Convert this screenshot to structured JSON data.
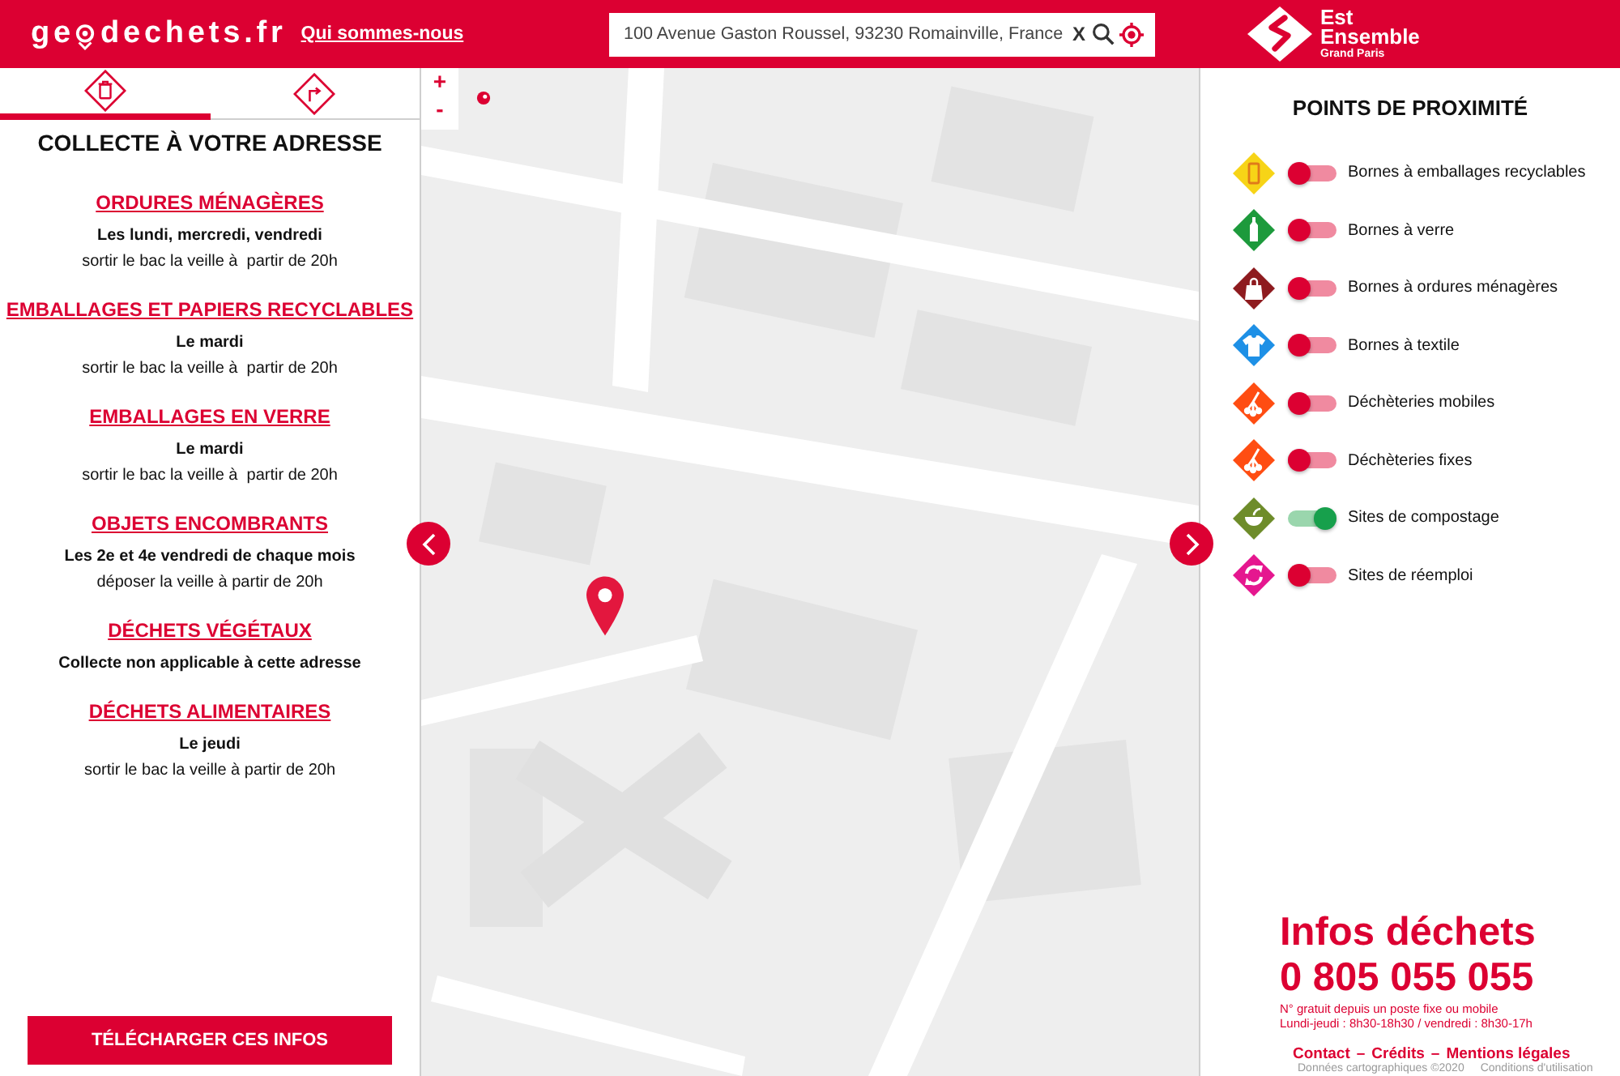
{
  "header": {
    "logo": {
      "before": "ge",
      "after": "dechets.fr"
    },
    "about_link": "Qui sommes-nous",
    "search": {
      "value": "100 Avenue Gaston Roussel, 93230 Romainville, France",
      "clear": "X"
    },
    "brand": [
      "Est",
      "Ensemble",
      "Grand Paris"
    ]
  },
  "left_panel": {
    "tabs": [
      {
        "selected": true
      },
      {
        "selected": false
      }
    ],
    "title": "COLLECTE À VOTRE ADRESSE",
    "sections": [
      {
        "heading": "ORDURES MÉNAGÈRES",
        "schedule": "Les lundi, mercredi, vendredi",
        "note": "sortir le bac la veille à  partir de 20h"
      },
      {
        "heading": "EMBALLAGES ET PAPIERS RECYCLABLES",
        "schedule": "Le mardi",
        "note": "sortir le bac la veille à  partir de 20h"
      },
      {
        "heading": "EMBALLAGES EN VERRE",
        "schedule": "Le mardi",
        "note": "sortir le bac la veille à  partir de 20h"
      },
      {
        "heading": "OBJETS ENCOMBRANTS",
        "schedule": "Les 2e et 4e vendredi de chaque mois",
        "note": "déposer la veille à partir de 20h"
      },
      {
        "heading": "DÉCHETS VÉGÉTAUX",
        "schedule": "Collecte non applicable à cette adresse"
      },
      {
        "heading": "DÉCHETS ALIMENTAIRES",
        "schedule": "Le jeudi",
        "note": "sortir le bac la veille à partir de 20h"
      }
    ],
    "download_button": "TÉLÉCHARGER CES INFOS"
  },
  "map": {
    "zoom_in": "+",
    "zoom_out": "-"
  },
  "right_panel": {
    "title": "POINTS DE PROXIMITÉ",
    "points": [
      {
        "label": "Bornes à emballages recyclables",
        "color": "#f7d417",
        "on": false
      },
      {
        "label": "Bornes à verre",
        "color": "#1d9a3c",
        "on": false
      },
      {
        "label": "Bornes à ordures ménagères",
        "color": "#8e1b1f",
        "on": false
      },
      {
        "label": "Bornes à textile",
        "color": "#1e90e6",
        "on": false
      },
      {
        "label": "Déchèteries mobiles",
        "color": "#ff4d12",
        "on": false
      },
      {
        "label": "Déchèteries fixes",
        "color": "#ff4d12",
        "on": false
      },
      {
        "label": "Sites de compostage",
        "color": "#6e8c2a",
        "on": true
      },
      {
        "label": "Sites de réemploi",
        "color": "#e5178f",
        "on": false
      }
    ],
    "hotline": {
      "title": "Infos déchets",
      "phone": "0 805 055 055",
      "notes": [
        "N° gratuit depuis un poste fixe ou mobile",
        "Lundi-jeudi : 8h30-18h30 / vendredi : 8h30-17h"
      ]
    },
    "footer_links": [
      "Contact",
      "Crédits",
      "Mentions légales"
    ],
    "footer_separators": [
      "–",
      "–"
    ],
    "map_attribution": [
      "Données cartographiques ©2020",
      "Conditions d'utilisation"
    ]
  }
}
